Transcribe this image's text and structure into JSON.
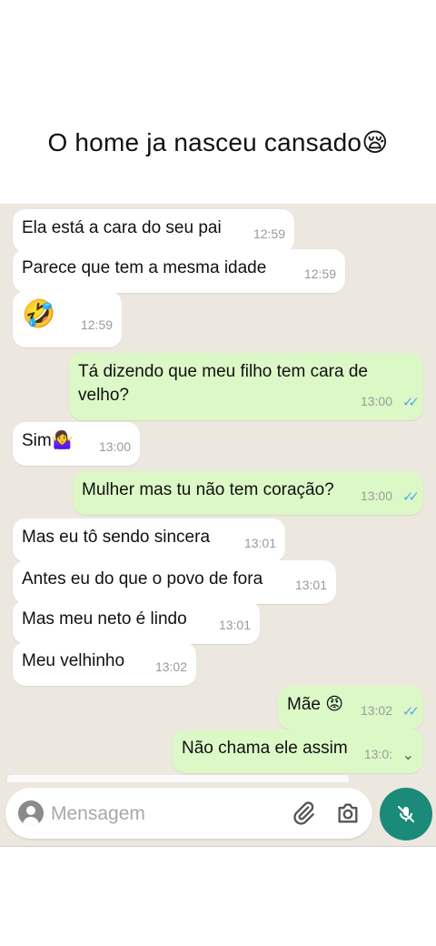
{
  "caption": {
    "text": "O home ja nasceu cansado😪"
  },
  "messages": [
    {
      "text": "Ela está a cara do seu pai",
      "time": "12:59",
      "dir": "in"
    },
    {
      "text": "Parece que tem a mesma idade",
      "time": "12:59",
      "dir": "in"
    },
    {
      "text": "🤣",
      "time": "12:59",
      "dir": "in"
    },
    {
      "text": "Tá dizendo que meu filho tem cara de velho?",
      "time": "13:00",
      "dir": "out"
    },
    {
      "text": "Sim🤷‍♀️",
      "time": "13:00",
      "dir": "in"
    },
    {
      "text": "Mulher mas tu não tem coração?",
      "time": "13:00",
      "dir": "out"
    },
    {
      "text": "Mas eu tô sendo sincera",
      "time": "13:01",
      "dir": "in"
    },
    {
      "text": "Antes eu do que o povo de fora",
      "time": "13:01",
      "dir": "in"
    },
    {
      "text": "Mas meu neto é lindo",
      "time": "13:01",
      "dir": "in"
    },
    {
      "text": "Meu velhinho",
      "time": "13:02",
      "dir": "in"
    },
    {
      "text": "Mãe 😡",
      "time": "13:02",
      "dir": "out"
    },
    {
      "text": "Não chama ele assim",
      "time": "13:0:",
      "dir": "out"
    }
  ],
  "composer": {
    "placeholder": "Mensagem"
  },
  "icons": {
    "avatar": "user-avatar-icon",
    "attach": "paperclip-icon",
    "camera": "camera-icon",
    "mic": "mic-muted-icon",
    "scroll": "double-chevron-down-icon",
    "ticks": "double-check-icon"
  },
  "colors": {
    "chat_bg": "#ece7df",
    "incoming": "#ffffff",
    "outgoing": "#dcf8c6",
    "accent": "#1b8a78",
    "ticks": "#5aa8e8"
  }
}
